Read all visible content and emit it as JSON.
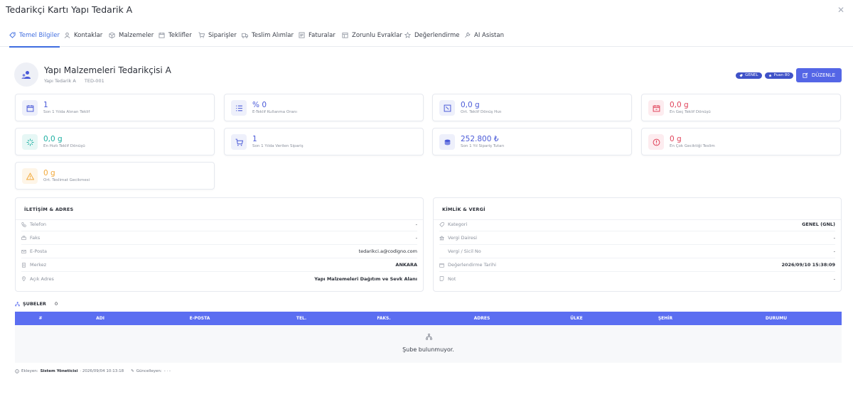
{
  "window": {
    "title": "Tedarikçi Kartı Yapı Tedarik A",
    "close_icon": "close-icon"
  },
  "tabs": [
    {
      "label": "Temel Bilgiler",
      "icon": "tag-icon",
      "active": true
    },
    {
      "label": "Kontaklar",
      "icon": "user-icon"
    },
    {
      "label": "Malzemeler",
      "icon": "box-icon"
    },
    {
      "label": "Teklifler",
      "icon": "calendar-icon"
    },
    {
      "label": "Siparişler",
      "icon": "cart-icon"
    },
    {
      "label": "Teslim Alımlar",
      "icon": "truck-icon"
    },
    {
      "label": "Faturalar",
      "icon": "invoice-icon"
    },
    {
      "label": "Zorunlu Evraklar",
      "icon": "document-icon"
    },
    {
      "label": "Değerlendirme",
      "icon": "star-icon"
    },
    {
      "label": "AI Asistan",
      "icon": "wrench-icon"
    }
  ],
  "supplier": {
    "name": "Yapı Malzemeleri Tedarikçisi A",
    "short_name": "Yapı Tedarik A",
    "code": "TED-001",
    "badges": [
      "GENEL",
      "Puan 80"
    ],
    "edit_label": "DÜZENLE"
  },
  "stats": [
    {
      "value": "1",
      "label": "Son 1 Yılda Alınan Teklif",
      "color": "#4a5ad8",
      "bg": "#eef0fb",
      "icon": "calendar-icon"
    },
    {
      "value": "% 0",
      "label": "E-Teklif Kullanma Oranı",
      "color": "#4a5ad8",
      "bg": "#eef0fb",
      "icon": "list-icon"
    },
    {
      "value": "0,0 g",
      "label": "Ort. Teklif Dönüş Hızı",
      "color": "#4a5ad8",
      "bg": "#eef0fb",
      "icon": "clock-icon"
    },
    {
      "value": "0,0 g",
      "label": "En Geç Teklif Dönüşü",
      "color": "#e0435a",
      "bg": "#fdecef",
      "icon": "calendar-late-icon"
    },
    {
      "value": "0,0 g",
      "label": "En Hızlı Teklif Dönüşü",
      "color": "#1fb0a3",
      "bg": "#e6f7f5",
      "icon": "sparkle-icon"
    },
    {
      "value": "1",
      "label": "Son 1 Yılda Verilen Sipariş",
      "color": "#4a5ad8",
      "bg": "#eef0fb",
      "icon": "cart-icon"
    },
    {
      "value": "252.800 ₺",
      "label": "Son 1 Yıl Sipariş Tutarı",
      "color": "#4a5ad8",
      "bg": "#eef0fb",
      "icon": "coins-icon"
    },
    {
      "value": "0 g",
      "label": "En Çok Geciktiği Teslim",
      "color": "#e0435a",
      "bg": "#fdecef",
      "icon": "alert-circle-icon"
    },
    {
      "value": "0 g",
      "label": "Ort. Teslimat Gecikmesi",
      "color": "#f2a93b",
      "bg": "#fef5e7",
      "icon": "warning-icon"
    }
  ],
  "contact": {
    "title": "İLETİŞİM & ADRES",
    "rows": [
      {
        "key": "Telefon",
        "value": "-",
        "icon": "phone-icon"
      },
      {
        "key": "Faks",
        "value": "-",
        "icon": "fax-icon"
      },
      {
        "key": "E-Posta",
        "value": "tedarikci.a@codigno.com",
        "icon": "mail-icon"
      },
      {
        "key": "Merkez",
        "value": "ANKARA",
        "icon": "building-icon",
        "bold": true
      },
      {
        "key": "Açık Adres",
        "value": "Yapı Malzemeleri Dağıtım ve Sevk Alanı",
        "icon": "pin-icon",
        "bold": true
      }
    ]
  },
  "identity": {
    "title": "KİMLİK & VERGİ",
    "rows": [
      {
        "key": "Kategori",
        "value": "GENEL (GNL)",
        "icon": "tag-icon",
        "bold": true
      },
      {
        "key": "Vergi Dairesi",
        "value": "-",
        "icon": "bank-icon"
      },
      {
        "key": "Vergi / Sicil No",
        "value": "-",
        "icon": ""
      },
      {
        "key": "Değerlendirme Tarihi",
        "value": "2026/09/10 15:38:09",
        "icon": "calendar-icon"
      },
      {
        "key": "Not",
        "value": "-",
        "icon": "note-icon"
      }
    ]
  },
  "branches": {
    "title": "ŞUBELER",
    "count": "0",
    "columns": [
      "#",
      "ADI",
      "E-POSTA",
      "TEL.",
      "FAKS.",
      "ADRES",
      "ÜLKE",
      "ŞEHİR",
      "DURUMU"
    ],
    "empty_text": "Şube bulunmuyor."
  },
  "footer": {
    "added_label": "Ekleyen:",
    "added_by": "Sistem Yöneticisi",
    "added_at": "· 2026/09/04 10:13:18",
    "updated_label": "Güncelleyen:",
    "updated_value": "- · -"
  }
}
